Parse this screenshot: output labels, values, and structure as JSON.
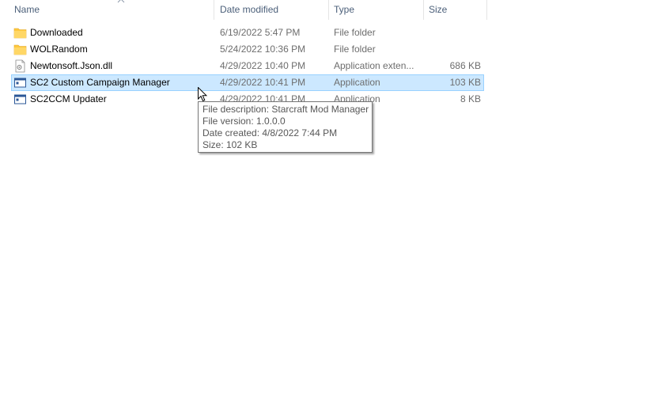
{
  "columns": {
    "name": "Name",
    "date": "Date modified",
    "type": "Type",
    "size": "Size"
  },
  "files": [
    {
      "icon": "folder-icon",
      "name": "Downloaded",
      "date": "6/19/2022 5:47 PM",
      "type": "File folder",
      "size": ""
    },
    {
      "icon": "folder-icon",
      "name": "WOLRandom",
      "date": "5/24/2022 10:36 PM",
      "type": "File folder",
      "size": ""
    },
    {
      "icon": "dll-file-icon",
      "name": "Newtonsoft.Json.dll",
      "date": "4/29/2022 10:40 PM",
      "type": "Application exten...",
      "size": "686 KB"
    },
    {
      "icon": "application-icon",
      "name": "SC2 Custom Campaign Manager",
      "date": "4/29/2022 10:41 PM",
      "type": "Application",
      "size": "103 KB"
    },
    {
      "icon": "application-icon",
      "name": "SC2CCM Updater",
      "date": "4/29/2022 10:41 PM",
      "type": "Application",
      "size": "8 KB"
    }
  ],
  "tooltip": {
    "description": "File description: Starcraft Mod Manager",
    "version": "File version: 1.0.0.0",
    "created": "Date created: 4/8/2022 7:44 PM",
    "size": "Size: 102 KB"
  },
  "colors": {
    "selection_bg": "#cce8ff",
    "selection_border": "#99d1ff",
    "header_text": "#4c607a",
    "folder": "#ffc83d"
  }
}
